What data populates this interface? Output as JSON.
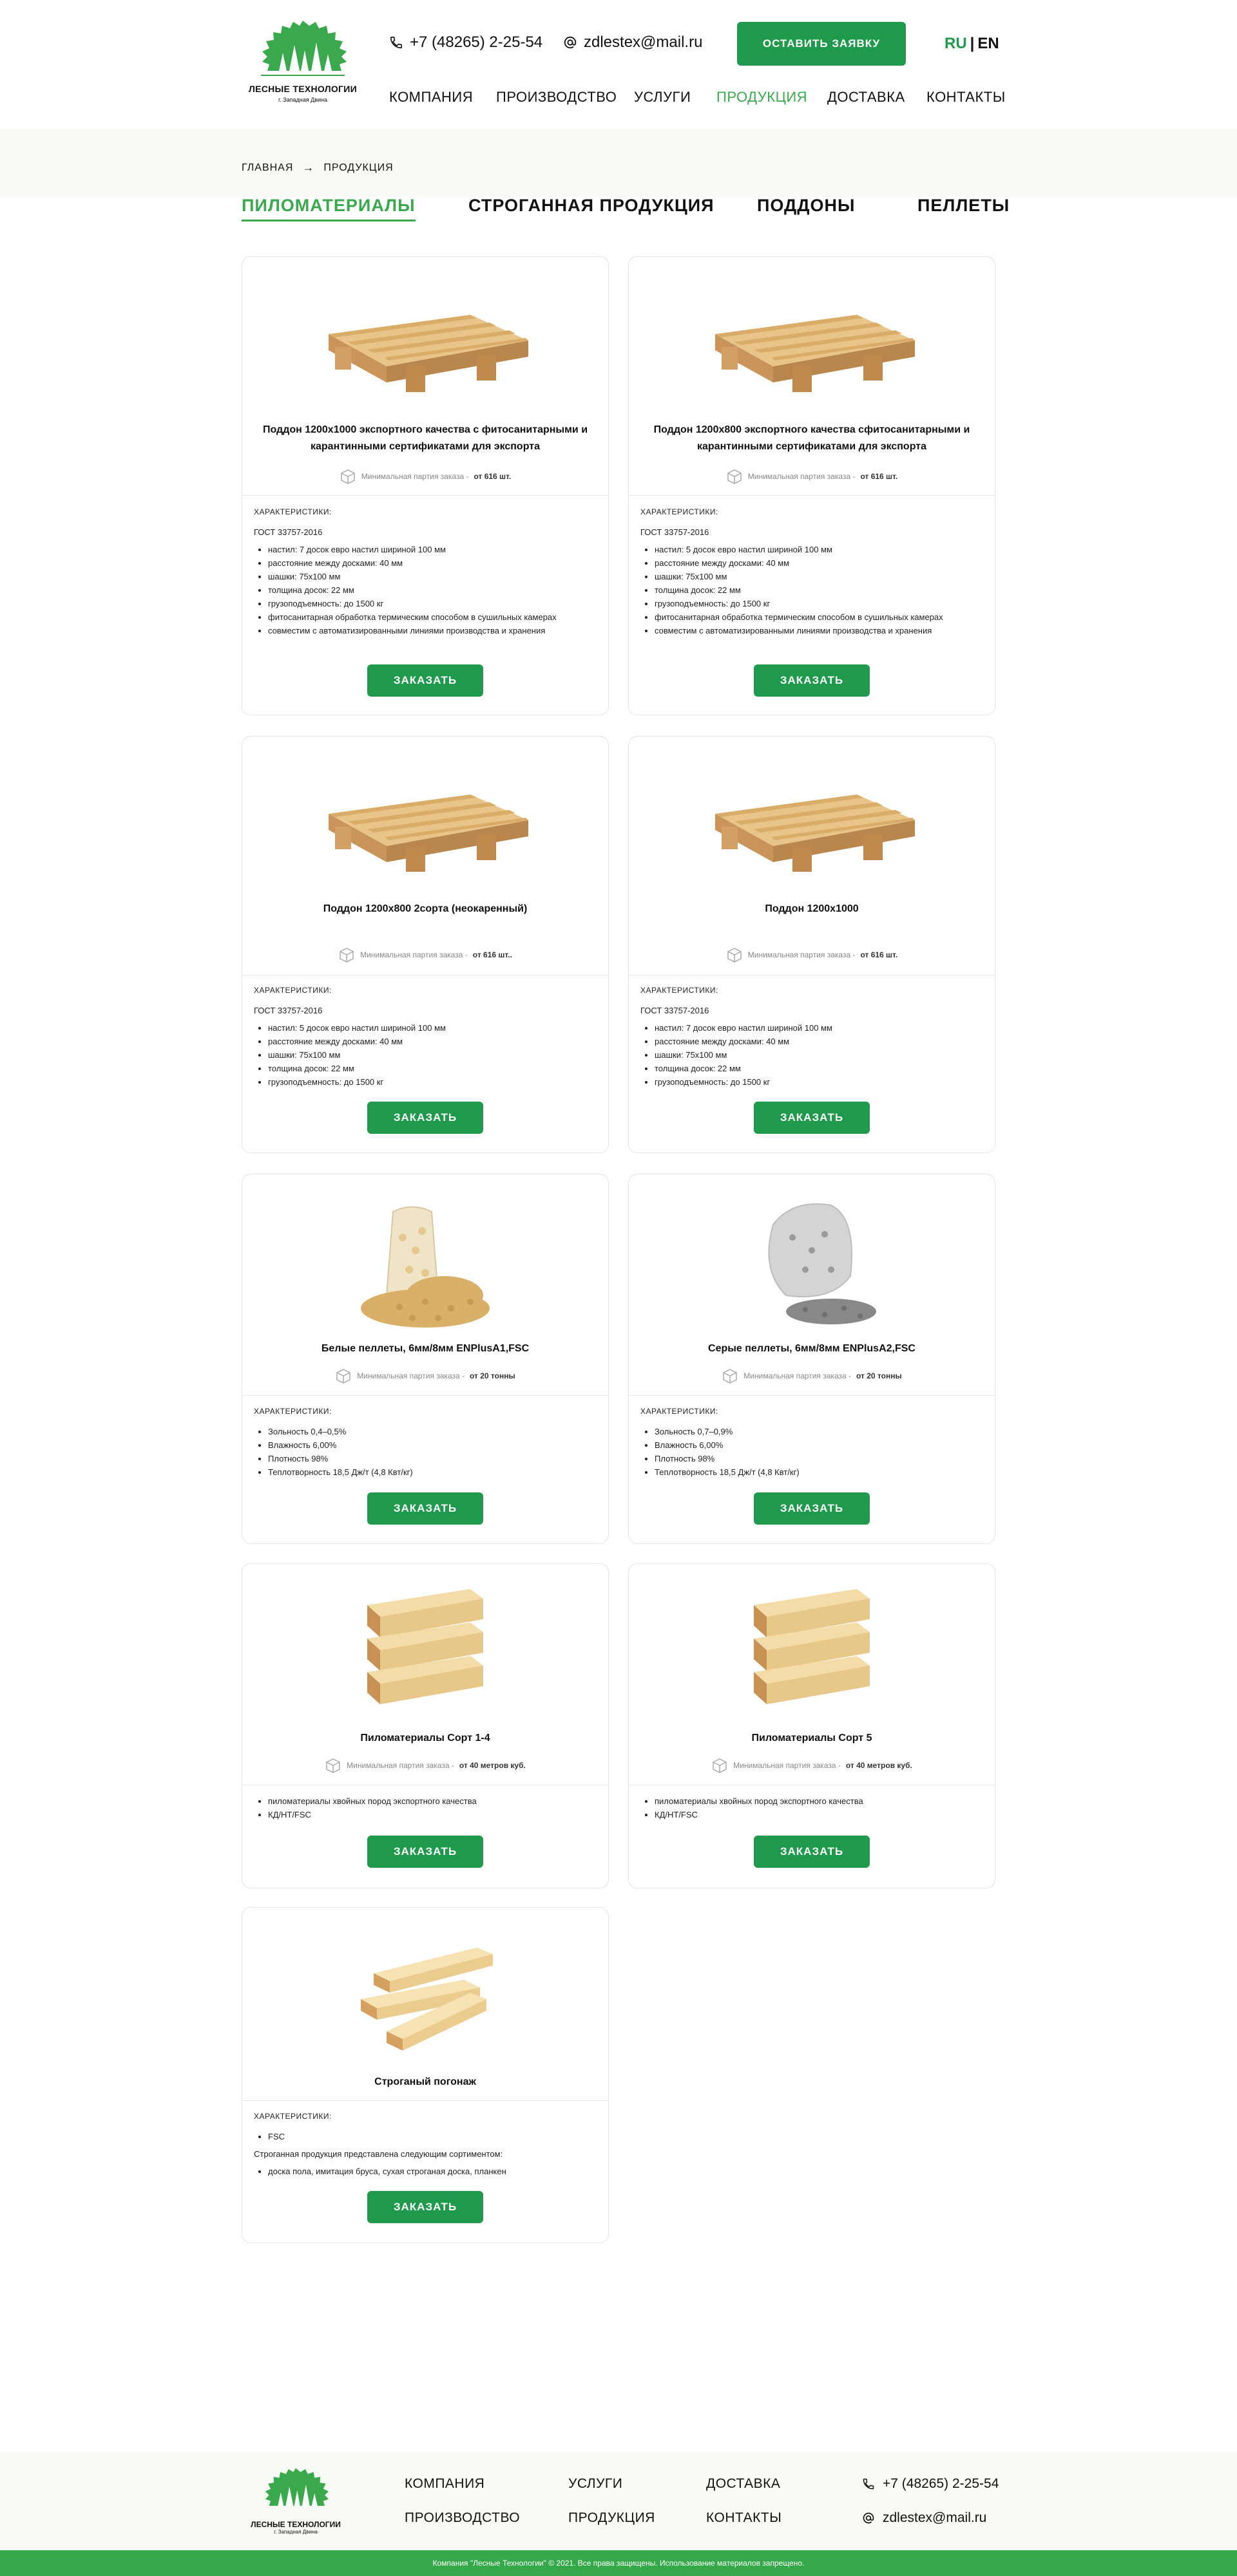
{
  "header": {
    "logo_text": "ЛЕСНЫЕ ТЕХНОЛОГИИ",
    "logo_sub": "г. Западная Двина",
    "phone": "+7 (48265) 2-25-54",
    "email": "zdlestex@mail.ru",
    "request_button": "ОСТАВИТЬ ЗАЯВКУ",
    "lang_ru": "RU",
    "lang_sep": "|",
    "lang_en": "EN",
    "nav": [
      "КОМПАНИЯ",
      "ПРОИЗВОДСТВО",
      "УСЛУГИ",
      "ПРОДУКЦИЯ",
      "ДОСТАВКА",
      "КОНТАКТЫ"
    ]
  },
  "breadcrumb": {
    "home": "ГЛАВНАЯ",
    "arrow": "→",
    "current": "ПРОДУКЦИЯ"
  },
  "tabs": [
    "ПИЛОМАТЕРИАЛЫ",
    "СТРОГАННАЯ ПРОДУКЦИЯ",
    "ПОДДОНЫ",
    "ПЕЛЛЕТЫ"
  ],
  "common": {
    "min_order_label": "Минимальная партия заказа -",
    "chars_label": "ХАРАКТЕРИСТИКИ:",
    "order_button": "ЗАКАЗАТЬ"
  },
  "products": [
    {
      "title": "Поддон 1200х1000 экспортного качества с фитосанитарными и карантинными сертификатами для экспорта",
      "min_order": "от 616 шт.",
      "image": "pallet",
      "gost": "ГОСТ 33757-2016",
      "items": [
        "настил: 7 досок евро настил шириной 100 мм",
        "расстояние между досками: 40 мм",
        "шашки: 75х100 мм",
        "толщина досок: 22 мм",
        "грузоподъемность: до 1500 кг",
        "фитосанитарная обработка термическим способом в сушильных камерах",
        "совместим с автоматизированными линиями производства и хранения"
      ]
    },
    {
      "title": "Поддон 1200х800 экспортного качества сфитосанитарными и карантинными сертификатами для экспорта",
      "min_order": "от 616 шт.",
      "image": "pallet",
      "gost": "ГОСТ 33757-2016",
      "items": [
        "настил: 5 досок евро настил шириной 100 мм",
        "расстояние между досками: 40 мм",
        "шашки: 75х100 мм",
        "толщина досок: 22 мм",
        "грузоподъемность: до 1500 кг",
        "фитосанитарная обработка термическим способом в сушильных камерах",
        "совместим с автоматизированными линиями производства и хранения"
      ]
    },
    {
      "title": "Поддон 1200х800 2сорта (неокаренный)",
      "min_order": "от 616 шт..",
      "image": "pallet",
      "gost": "ГОСТ 33757-2016",
      "items": [
        "настил: 5 досок евро настил шириной 100 мм",
        "расстояние между досками: 40 мм",
        "шашки: 75х100 мм",
        "толщина досок: 22 мм",
        "грузоподъемность: до 1500 кг"
      ]
    },
    {
      "title": "Поддон 1200х1000",
      "min_order": "от 616 шт.",
      "image": "pallet",
      "gost": "ГОСТ 33757-2016",
      "items": [
        "настил: 7 досок евро настил шириной 100 мм",
        "расстояние между досками: 40 мм",
        "шашки: 75х100 мм",
        "толщина досок: 22 мм",
        "грузоподъемность: до 1500 кг"
      ]
    },
    {
      "title": "Белые пеллеты, 6мм/8мм ENPlusA1,FSC",
      "min_order": "от 20 тонны",
      "image": "pellets-white",
      "items": [
        "Зольность 0,4–0,5%",
        "Влажность 6,00%",
        "Плотность 98%",
        "Теплотворность 18,5 Дж/т (4,8 Квт/кг)"
      ]
    },
    {
      "title": "Серые пеллеты, 6мм/8мм ENPlusA2,FSC",
      "min_order": "от 20 тонны",
      "image": "pellets-gray",
      "items": [
        "Зольность 0,7–0,9%",
        "Влажность 6,00%",
        "Плотность 98%",
        "Теплотворность 18,5 Дж/т (4,8 Квт/кг)"
      ]
    },
    {
      "title": "Пиломатериалы Сорт 1-4",
      "min_order": "от 40 метров куб.",
      "image": "lumber",
      "items": [
        "пиломатериалы хвойных пород экспортного качества",
        "КД/НТ/FSC"
      ]
    },
    {
      "title": "Пиломатериалы Сорт 5",
      "min_order": "от 40 метров куб.",
      "image": "lumber",
      "items": [
        "пиломатериалы хвойных пород экспортного качества",
        "КД/НТ/FSC"
      ]
    },
    {
      "title": "Строганый погонаж",
      "image": "planed",
      "items": [
        "FSC"
      ],
      "extra_text": "Строганная продукция представлена следующим сортиментом:",
      "extra_items": [
        "доска пола, имитация бруса, сухая строганая доска, планкен"
      ]
    }
  ],
  "footer": {
    "links_col1": [
      "КОМПАНИЯ",
      "ПРОИЗВОДСТВО"
    ],
    "links_col2": [
      "УСЛУГИ",
      "ПРОДУКЦИЯ"
    ],
    "links_col3": [
      "ДОСТАВКА",
      "КОНТАКТЫ"
    ],
    "phone": "+7 (48265) 2-25-54",
    "email": "zdlestex@mail.ru",
    "logo_text": "ЛЕСНЫЕ ТЕХНОЛОГИИ",
    "logo_sub": "г. Западная Двина",
    "copyright": "Компания \"Лесные Технологии\" © 2021. Все права защищены. Использование материалов запрещено."
  },
  "colors": {
    "accent": "#1f9a4c",
    "accent_light": "#3aa84c",
    "band_bg": "#f7fbf4",
    "copyright_bg": "#35a84a"
  },
  "icons": [
    "phone-icon",
    "email-icon",
    "box-icon",
    "arrow-right-icon",
    "tree-logo"
  ]
}
